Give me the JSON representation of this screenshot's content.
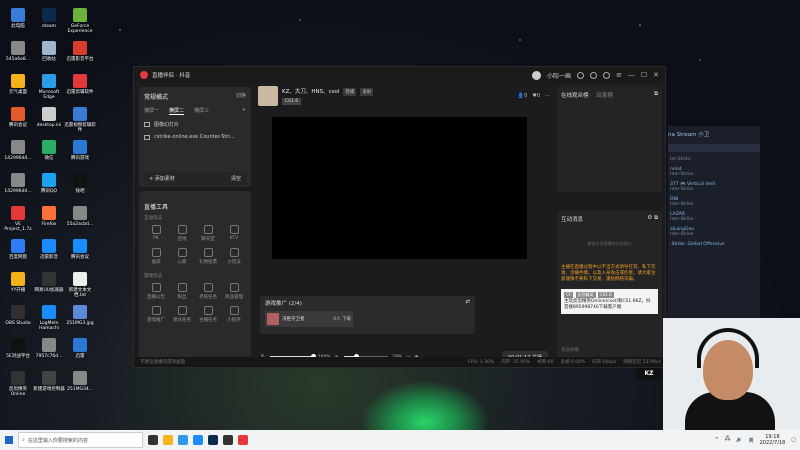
{
  "desktop_icons": [
    {
      "label": "此电脑",
      "color": "#3a7bd5"
    },
    {
      "label": "steam",
      "color": "#0b2a4a"
    },
    {
      "label": "GeForce Experience",
      "color": "#6bb33c"
    },
    {
      "label": "545a6e8...",
      "color": "#888888"
    },
    {
      "label": "回收站",
      "color": "#9fb6cc"
    },
    {
      "label": "迅雷影音平台",
      "color": "#d83a2f"
    },
    {
      "label": "元气桌面",
      "color": "#f5b21b"
    },
    {
      "label": "Microsoft Edge",
      "color": "#2b9ce8"
    },
    {
      "label": "迅雷剪辑软件",
      "color": "#e5383b"
    },
    {
      "label": "腾讯会议",
      "color": "#e05a2b"
    },
    {
      "label": "desktop.ini",
      "color": "#cccccc"
    },
    {
      "label": "迅雷视频剪辑软件",
      "color": "#3a7bd5"
    },
    {
      "label": "142996d4...",
      "color": "#888888"
    },
    {
      "label": "微信",
      "color": "#2aae67"
    },
    {
      "label": "腾讯游戏",
      "color": "#2a78d6"
    },
    {
      "label": "142996d4...",
      "color": "#888888"
    },
    {
      "label": "腾讯QQ",
      "color": "#1da1f2"
    },
    {
      "label": "快吧",
      "color": "#111111"
    },
    {
      "label": "VE Project_1.7z",
      "color": "#e5383b"
    },
    {
      "label": "Firefox",
      "color": "#ff7139"
    },
    {
      "label": "55a2acbd...",
      "color": "#888888"
    },
    {
      "label": "百度网盘",
      "color": "#2f7cf6"
    },
    {
      "label": "迅雷影音",
      "color": "#1a8cff"
    },
    {
      "label": "腾讯会议",
      "color": "#1a8cff"
    },
    {
      "label": "YY开播",
      "color": "#f5b21b"
    },
    {
      "label": "网易UU加速器",
      "color": "#333333"
    },
    {
      "label": "新建文本文档.txt",
      "color": "#eeeeee"
    },
    {
      "label": "OBS Studio",
      "color": "#302e31"
    },
    {
      "label": "LogMeIn Hamachi",
      "color": "#1a8cff"
    },
    {
      "label": "251MG3.jpg",
      "color": "#5b8bd6"
    },
    {
      "label": "5E对战平台",
      "color": "#111111"
    },
    {
      "label": "7957c76d...",
      "color": "#888888"
    },
    {
      "label": "迅雷",
      "color": "#2a78d6"
    },
    {
      "label": "反恐精英Online",
      "color": "#333333"
    },
    {
      "label": "新建游戏控制器",
      "color": "#444444"
    },
    {
      "label": "251MG34...",
      "color": "#888888"
    }
  ],
  "app": {
    "title": "直播伴侣 · 抖音",
    "user_name": "小际一画",
    "win_controls": {
      "min": "—",
      "max": "☐",
      "close": "✕"
    }
  },
  "left": {
    "mode_title": "常规横式",
    "mode_switch": "切换",
    "scene_tabs": [
      "横屏一",
      "横屏二",
      "横屏三"
    ],
    "sources": [
      "图像幻灯片",
      "cstrike-online.exe Counter-Stri..."
    ],
    "add_source": "+ 添加素材",
    "clear_label": "清空",
    "tools_title": "直播工具",
    "interact_label": "互动玩法",
    "game_label": "游戏玩法",
    "tools_row1": [
      "PK",
      "连线",
      "聊天室",
      "KTV"
    ],
    "tools_row2": [
      "福袋",
      "心愿",
      "礼物投票",
      "小玩法"
    ],
    "tools_row3": [
      "直播公告",
      "粉丝",
      "考核任务",
      "商品管理"
    ],
    "tools_row4": [
      "游戏推广",
      "观众任务",
      "主播任务",
      "小程序"
    ]
  },
  "preview": {
    "streamer_name": "KZ、大刀、HNS、csol",
    "tags": [
      "稳播",
      "发射"
    ],
    "game_tag": "CS1.6",
    "viewers": "0",
    "likes": "0",
    "promo_title": "游戏推广 (2/4)",
    "promo_item": "决胜守卫者",
    "promo_count": "0人 下载",
    "volume": "100%",
    "volume_fraction": 1.0,
    "mic_volume": "29%",
    "mic_fraction": 0.29,
    "timer": "00:01:17 关播"
  },
  "right": {
    "audience_tab": "在线观众榜",
    "fans_tab": "玩家榜",
    "messages_title": "互动消息",
    "faint_text": "解锁本场直播的在线观众",
    "warning": "主播在直播过程中以不当方式诱导打赏、私下交易、涉嫌色情、以及人身攻击或危害，请大家注意谨慎不要私下交易，谨防网络诈骗。",
    "card_badges": [
      "CF",
      "反恐精英",
      "CS1.6"
    ],
    "card_text": "主玩反恐精英Online(csol)和CS1.6KZ，抖音搜895998746下载客户端",
    "input_placeholder": "发送弹幕"
  },
  "statusbar": {
    "notice": "不建议直播的游戏画面",
    "cpu": "CPU: 3.36%",
    "mem": "内存: 35.00%",
    "fps": "帧率:60",
    "drop": "丢帧:0.00%",
    "bitrate": "码率:0kbps",
    "network": "网络延迟 237Kb/s"
  },
  "steam": {
    "header": "na Stream 小卫",
    "messages": [
      {
        "user": "",
        "game": "ter-Strike"
      },
      {
        "user": "rvind",
        "game": "nter-Strike"
      },
      {
        "user": "377 🎮 Vertical limit",
        "game": "nter-Strike"
      },
      {
        "user": "ONI",
        "game": "nter-Strike"
      },
      {
        "user": "LAZAR",
        "game": "nter-Strike"
      },
      {
        "user": "aiLangGou",
        "game": "nter-Strike"
      },
      {
        "user": "-Strike: Global Offensive",
        "game": ""
      }
    ]
  },
  "kz_logo": "KZ",
  "taskbar": {
    "search_placeholder": "在这里输入你要搜索的内容",
    "time": "19:18",
    "date": "2022/7/18",
    "lang": "英"
  }
}
